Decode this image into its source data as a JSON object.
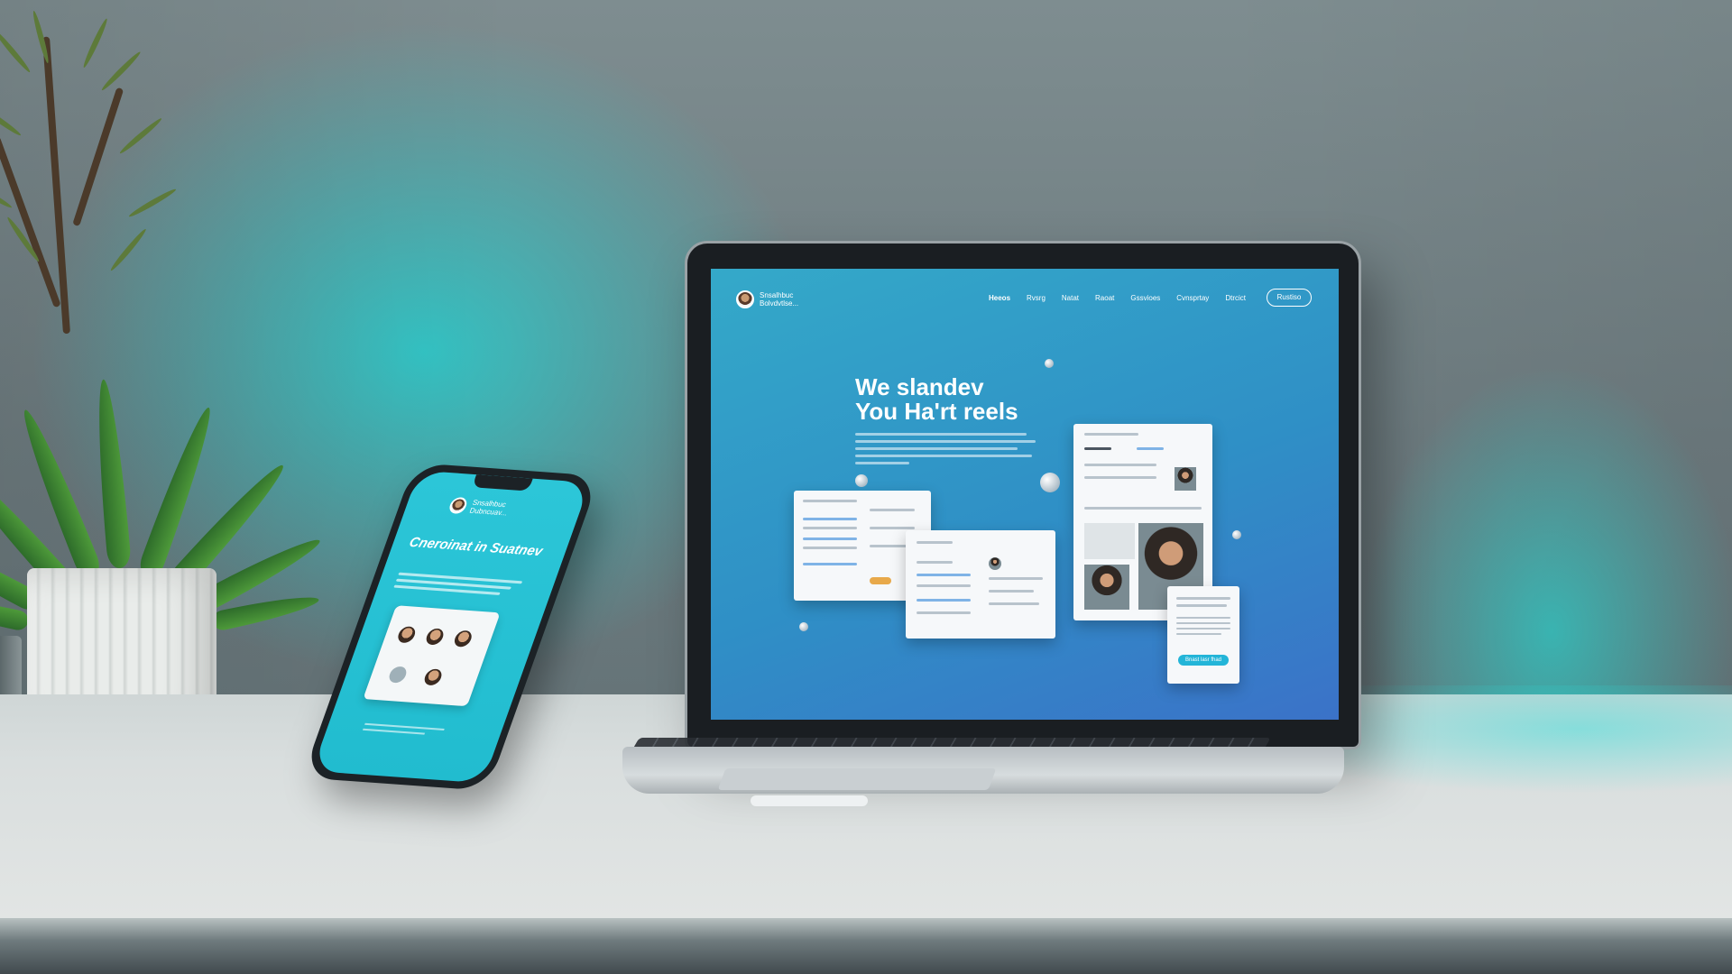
{
  "scene": {
    "accent_color": "#22d6d6",
    "screen_color": "#2f8fc6"
  },
  "phone": {
    "brand": "Snsalhbuc Dubncuav...",
    "title": "Cneroinat in Suatnev"
  },
  "laptop_site": {
    "brand": "Snsalhbuc Bolvdvtlse...",
    "nav": [
      "Heeos",
      "Rvsrg",
      "Natat",
      "Raoat",
      "Gssvioes",
      "Cvnsprtay",
      "Dtrcict"
    ],
    "cta": "Rustiso",
    "hero_title_line1": "We slandev",
    "hero_title_line2": "You Ha'rt reels",
    "card_btn": "Bnast lasr fhad"
  }
}
